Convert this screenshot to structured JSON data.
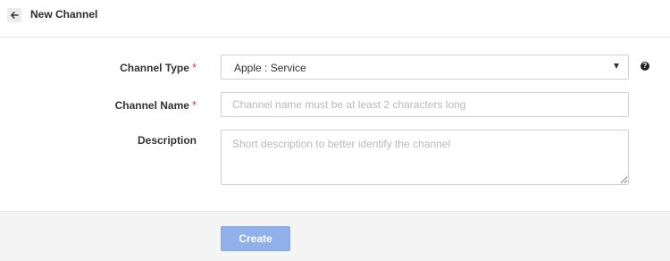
{
  "header": {
    "back_icon": "arrow-left-icon",
    "title": "New Channel"
  },
  "form": {
    "channel_type": {
      "label": "Channel Type",
      "required_mark": "*",
      "selected_value": "Apple : Service",
      "help_icon": "question-circle-icon",
      "help_glyph": "?"
    },
    "channel_name": {
      "label": "Channel Name",
      "required_mark": "*",
      "placeholder": "Channel name must be at least 2 characters long",
      "value": ""
    },
    "description": {
      "label": "Description",
      "placeholder": "Short description to better identify the channel",
      "value": ""
    }
  },
  "footer": {
    "create_label": "Create"
  },
  "colors": {
    "required": "#e0343d",
    "create_button_bg": "#8fb0ea",
    "footer_bg": "#f4f4f4"
  }
}
